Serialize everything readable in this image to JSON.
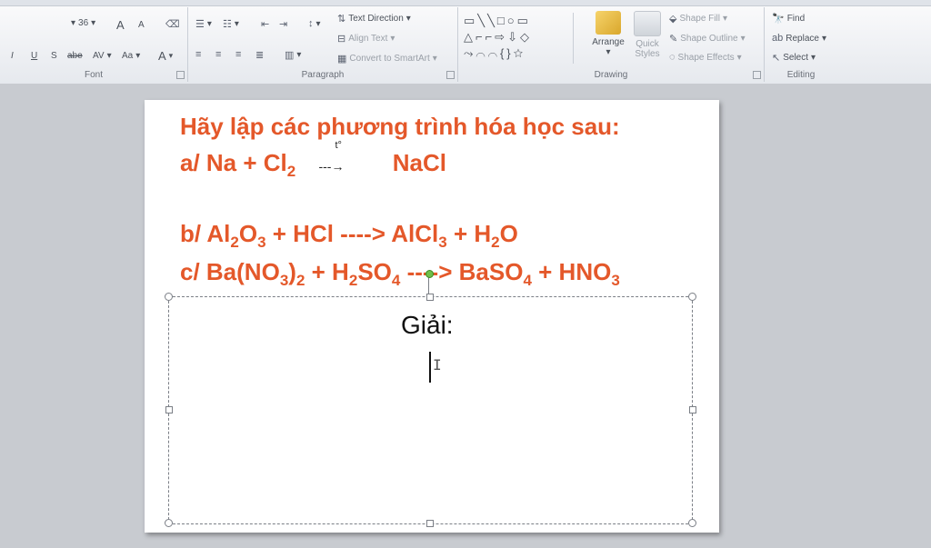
{
  "ribbon": {
    "font_group": {
      "label": "Font",
      "size": "36",
      "buttons": [
        "A",
        "A",
        "I",
        "U",
        "S",
        "abe",
        "AV",
        "Aa",
        "A"
      ]
    },
    "paragraph_group": {
      "label": "Paragraph",
      "text_direction": "Text Direction",
      "align_text": "Align Text",
      "convert_smartart": "Convert to SmartArt"
    },
    "drawing_group": {
      "label": "Drawing",
      "arrange": "Arrange",
      "quick_styles_1": "Quick",
      "quick_styles_2": "Styles",
      "shape_fill": "Shape Fill",
      "shape_outline": "Shape Outline",
      "shape_effects": "Shape Effects"
    },
    "editing_group": {
      "label": "Editing",
      "find": "Find",
      "replace": "Replace",
      "select": "Select"
    }
  },
  "slide": {
    "title": "Hãy lập các phương trình hóa học sau:",
    "eq_a": {
      "prefix": "a/ Na + Cl",
      "sub": "2",
      "arrow_label": "t°",
      "arrow": "---→",
      "product": "NaCl"
    },
    "eq_b": [
      "b/ Al",
      "2",
      "O",
      "3",
      " + HCl ----> AlCl",
      "3",
      " + H",
      "2",
      "O"
    ],
    "eq_c": [
      "c/ Ba(NO",
      "3",
      ")",
      "2",
      " + H",
      "2",
      "SO",
      "4",
      " ----> BaSO",
      "4",
      " + HNO",
      "3"
    ],
    "placeholder_text": "Giải:"
  },
  "colors": {
    "equation_text": "#e4582a",
    "ribbon_bg": "#e6e9ee",
    "workspace_bg": "#c8cbd0"
  }
}
